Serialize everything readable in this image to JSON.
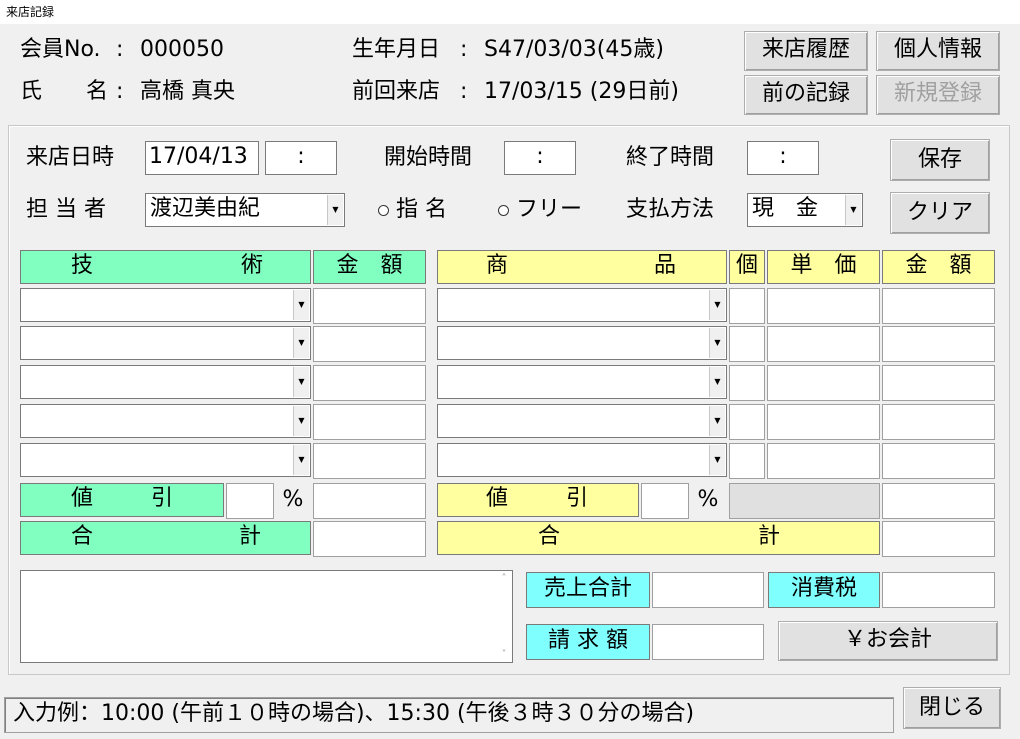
{
  "window": {
    "title": "来店記録"
  },
  "header": {
    "member_no_label": "会員No.",
    "sep": ":",
    "member_no": "000050",
    "name_label": "氏　　名",
    "name": "高橋 真央",
    "birth_label": "生年月日",
    "birth": "S47/03/03(45歳)",
    "last_visit_label": "前回来店",
    "last_visit": "17/03/15 (29日前)"
  },
  "top_buttons": {
    "history": "来店履歴",
    "personal": "個人情報",
    "prev": "前の記録",
    "new": "新規登録"
  },
  "form": {
    "visit_label": "来店日時",
    "visit_date": "17/04/13",
    "visit_time": ":",
    "start_label": "開始時間",
    "start_time": ":",
    "end_label": "終了時間",
    "end_time": ":",
    "staff_label": "担 当 者",
    "staff": "渡辺美由紀",
    "radio_designated": "指 名",
    "radio_free": "フリー",
    "pay_label": "支払方法",
    "pay": "現　金",
    "save": "保存",
    "clear": "クリア"
  },
  "tech": {
    "col_item": [
      "技",
      "術"
    ],
    "col_amount": "金　額",
    "discount": [
      "値",
      "引"
    ],
    "percent": "%",
    "total": [
      "合",
      "計"
    ]
  },
  "goods": {
    "col_item": [
      "商",
      "品"
    ],
    "col_qty": "個",
    "col_unit": "単　価",
    "col_amount": "金　額",
    "discount": [
      "値",
      "引"
    ],
    "percent": "%",
    "total": [
      "合",
      "計"
    ]
  },
  "summary": {
    "sales_total": "売上合計",
    "tax": "消費税",
    "billing": "請 求 額",
    "checkout": "￥お会計"
  },
  "footer": {
    "hint": "入力例：10:00 (午前１０時の場合)、15:30 (午後３時３０分の場合)",
    "close": "閉じる"
  }
}
